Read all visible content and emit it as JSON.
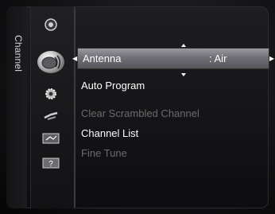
{
  "sidebar": {
    "title": "Channel"
  },
  "icons": [
    {
      "name": "picture-icon"
    },
    {
      "name": "channel-satellite-icon"
    },
    {
      "name": "setup-gear-icon"
    },
    {
      "name": "input-plug-icon"
    },
    {
      "name": "application-icon"
    },
    {
      "name": "support-help-icon",
      "glyph": "?"
    }
  ],
  "menu": {
    "selected": {
      "label": "Antenna",
      "value": ": Air"
    },
    "items": [
      {
        "label": "Auto Program",
        "enabled": true
      },
      {
        "label": "Clear Scrambled Channel",
        "enabled": false
      },
      {
        "label": "Channel List",
        "enabled": true
      },
      {
        "label": "Fine Tune",
        "enabled": false
      }
    ]
  },
  "colors": {
    "highlight": "#7a7a80",
    "disabled": "#6b6b6b",
    "text": "#ffffff"
  }
}
